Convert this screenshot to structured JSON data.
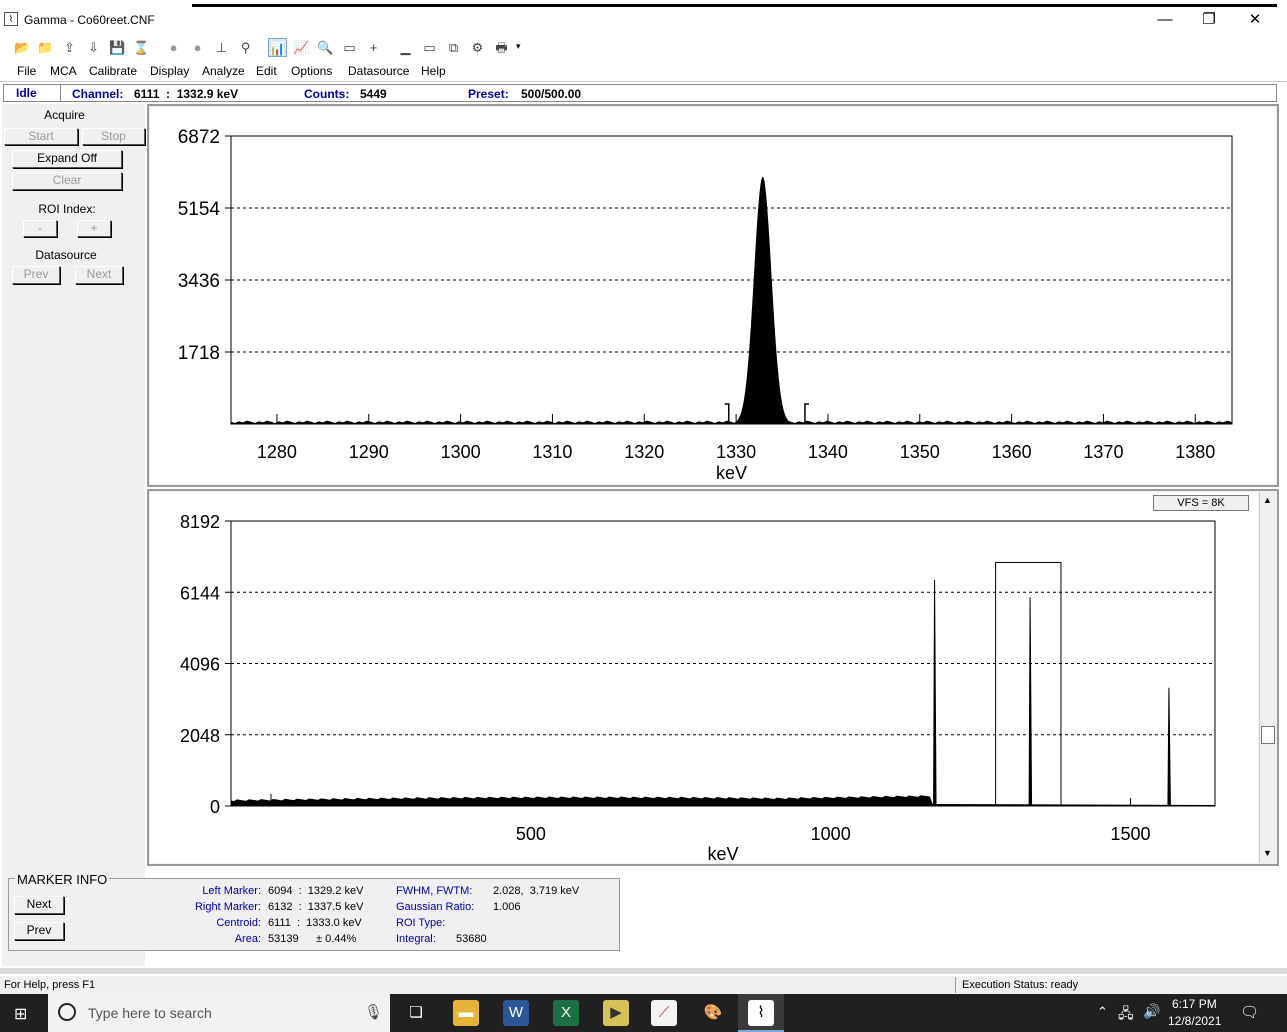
{
  "window": {
    "title": "Gamma - Co60reet.CNF",
    "min": "—",
    "max": "❐",
    "close": "✕"
  },
  "toolbar": [
    "📂",
    "📁",
    "⇪",
    "⇩",
    "💾",
    "⌛",
    "●",
    "●",
    "⊥",
    "⚲",
    "📊",
    "📈",
    "🔍",
    "▭",
    "+",
    "▁",
    "▭",
    "⧉",
    "⚙",
    "🖶"
  ],
  "menu": [
    "File",
    "MCA",
    "Calibrate",
    "Display",
    "Analyze",
    "Edit",
    "Options",
    "Datasource",
    "Help"
  ],
  "status": {
    "state": "Idle",
    "channel_label": "Channel:",
    "channel_value": "6111  :  1332.9 keV",
    "counts_label": "Counts:",
    "counts_value": "5449",
    "preset_label": "Preset:",
    "preset_value": "500/500.00"
  },
  "left": {
    "acquire": "Acquire",
    "start": "Start",
    "stop": "Stop",
    "expand": "Expand Off",
    "clear": "Clear",
    "roi_index": "ROI Index:",
    "roi_minus": "-",
    "roi_plus": "+",
    "datasource": "Datasource",
    "prev": "Prev",
    "next": "Next"
  },
  "chart_data": [
    {
      "type": "area",
      "xlabel": "keV",
      "xlim": [
        1275,
        1384
      ],
      "ylim": [
        0,
        6872
      ],
      "yticks": [
        "6872",
        "5154",
        "3436",
        "1718"
      ],
      "xticks": [
        "1280",
        "1290",
        "1300",
        "1310",
        "1320",
        "1330",
        "1340",
        "1350",
        "1360",
        "1370",
        "1380"
      ],
      "peak_keV": 1332.9,
      "peak_counts": 5900,
      "roi_markers_keV": [
        1329.2,
        1337.5
      ]
    },
    {
      "type": "area",
      "xlabel": "keV",
      "ylim": [
        0,
        8192
      ],
      "yticks": [
        "8192",
        "6144",
        "4096",
        "2048",
        "0"
      ],
      "xticks": [
        "500",
        "1000",
        "1500"
      ],
      "vfs": "VFS = 8K",
      "peaks_keV": [
        1173.2,
        1332.5,
        1564
      ],
      "peaks_counts": [
        6500,
        6000,
        3400
      ]
    }
  ],
  "marker": {
    "title": "MARKER INFO",
    "next": "Next",
    "prev": "Prev",
    "left_label": "Left Marker:",
    "left_value": "6094  :  1329.2 keV",
    "right_label": "Right Marker:",
    "right_value": "6132  :  1337.5 keV",
    "centroid_label": "Centroid:",
    "centroid_value": "6111  :  1333.0 keV",
    "area_label": "Area:",
    "area_value": "53139",
    "area_err": "± 0.44%",
    "fwhm_label": "FWHM, FWTM:",
    "fwhm_value": "2.028,  3.719 keV",
    "gauss_label": "Gaussian Ratio:",
    "gauss_value": "1.006",
    "roi_type_label": "ROI Type:",
    "integral_label": "Integral:",
    "integral_value": "53680"
  },
  "statusbar": {
    "help": "For Help, press F1",
    "exec": "Execution Status: ready"
  },
  "taskbar": {
    "search": "Type here to search",
    "time": "6:17 PM",
    "date": "12/8/2021"
  }
}
